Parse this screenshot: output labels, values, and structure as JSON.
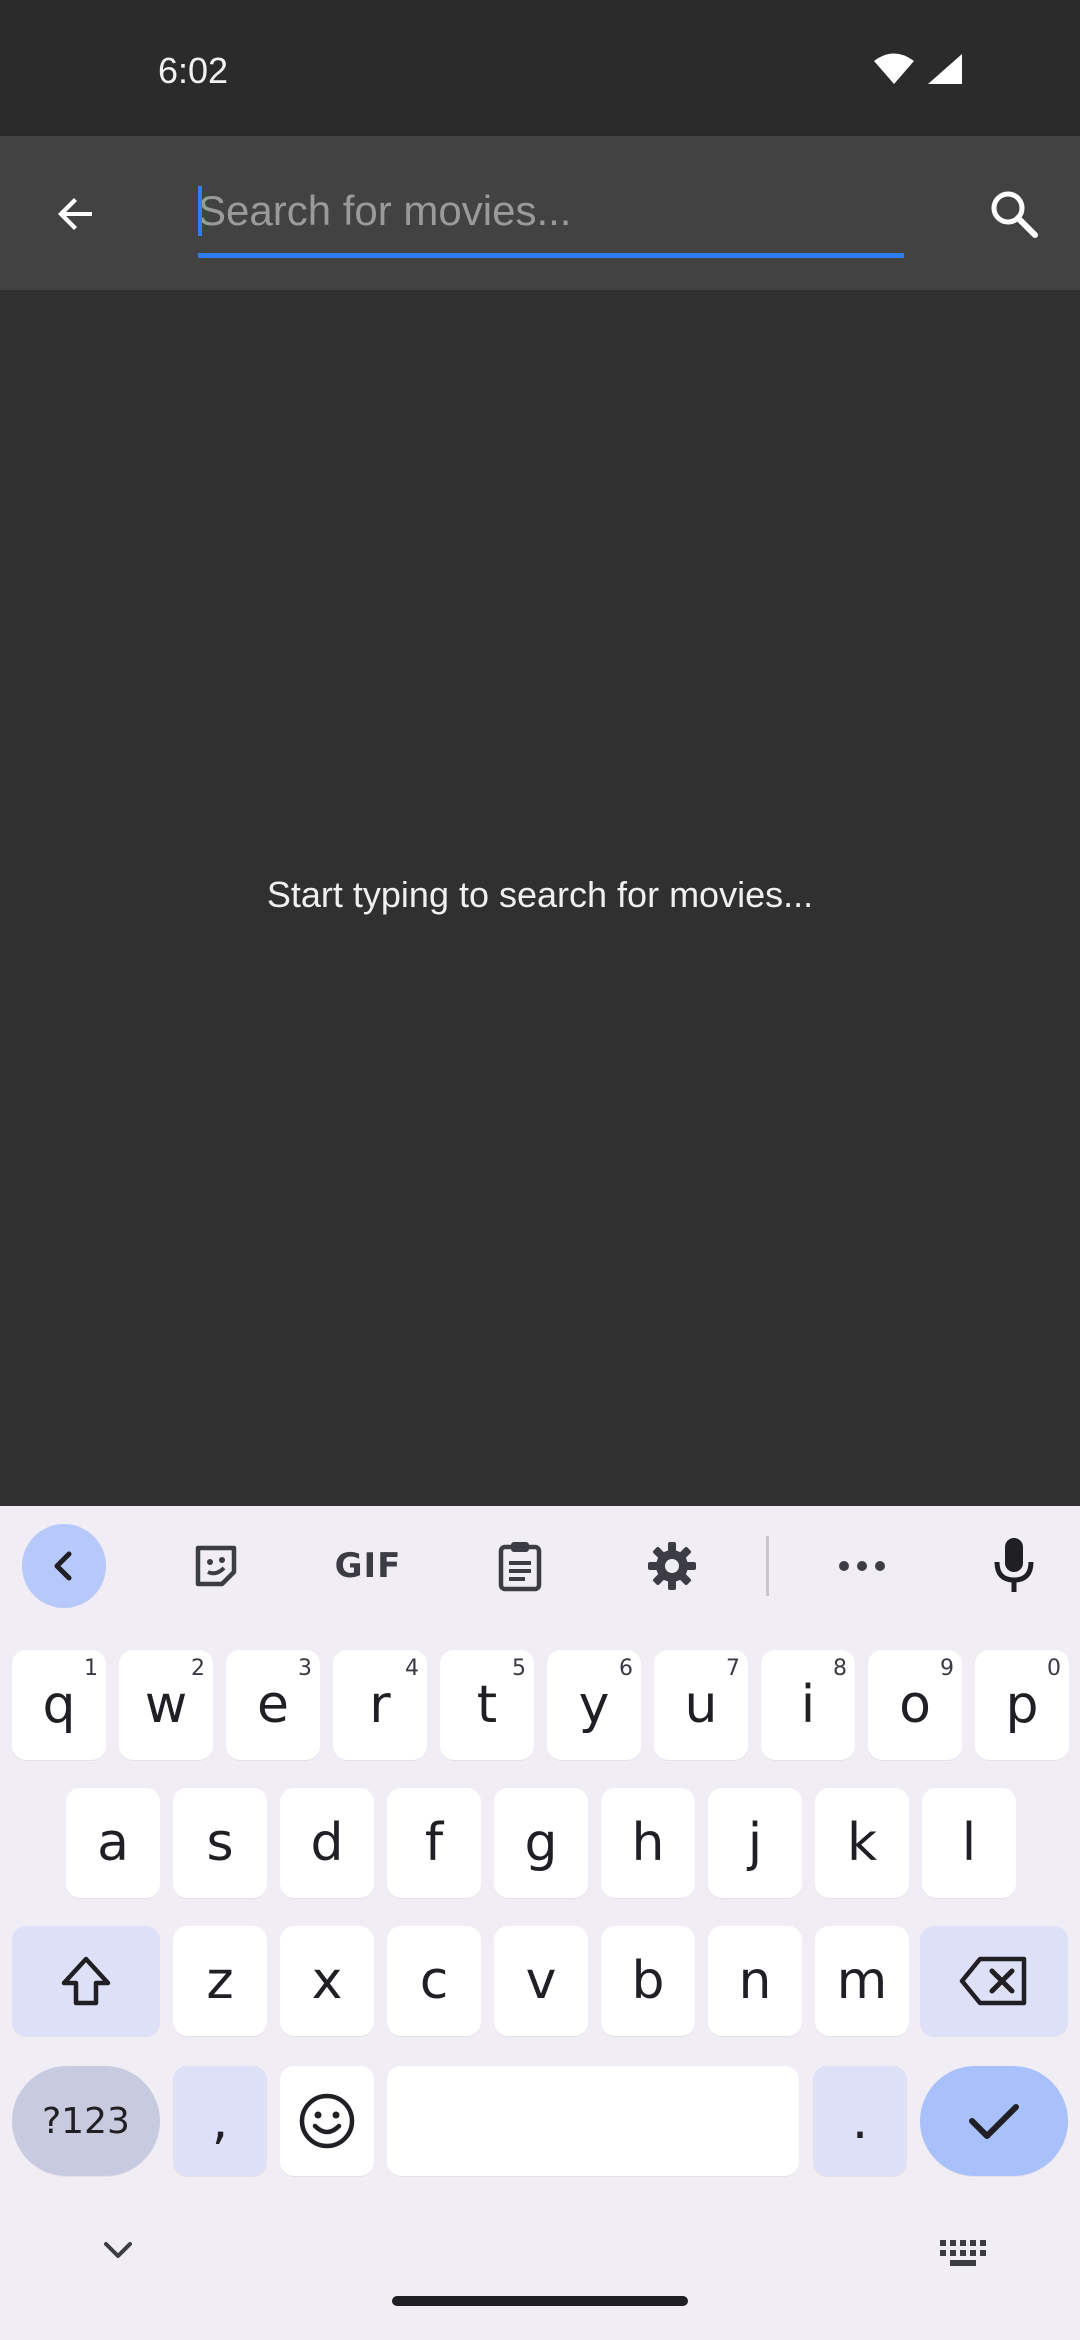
{
  "status_bar": {
    "time": "6:02",
    "icons": [
      "wifi-icon",
      "cell-signal-icon"
    ]
  },
  "app_bar": {
    "back_icon": "arrow-back-icon",
    "search_placeholder": "Search for movies...",
    "search_value": "",
    "search_icon": "search-icon",
    "accent_color": "#2e7df6"
  },
  "main": {
    "empty_message": "Start typing to search for movies..."
  },
  "keyboard": {
    "toolbar": [
      "collapse-icon",
      "sticker-icon",
      "GIF",
      "clipboard-icon",
      "gear-icon",
      "more-icon",
      "mic-icon"
    ],
    "rows": [
      [
        {
          "k": "q",
          "h": "1"
        },
        {
          "k": "w",
          "h": "2"
        },
        {
          "k": "e",
          "h": "3"
        },
        {
          "k": "r",
          "h": "4"
        },
        {
          "k": "t",
          "h": "5"
        },
        {
          "k": "y",
          "h": "6"
        },
        {
          "k": "u",
          "h": "7"
        },
        {
          "k": "i",
          "h": "8"
        },
        {
          "k": "o",
          "h": "9"
        },
        {
          "k": "p",
          "h": "0"
        }
      ],
      [
        "a",
        "s",
        "d",
        "f",
        "g",
        "h",
        "j",
        "k",
        "l"
      ],
      [
        "z",
        "x",
        "c",
        "v",
        "b",
        "n",
        "m"
      ]
    ],
    "symbols_label": "?123",
    "comma": ",",
    "period": "."
  }
}
